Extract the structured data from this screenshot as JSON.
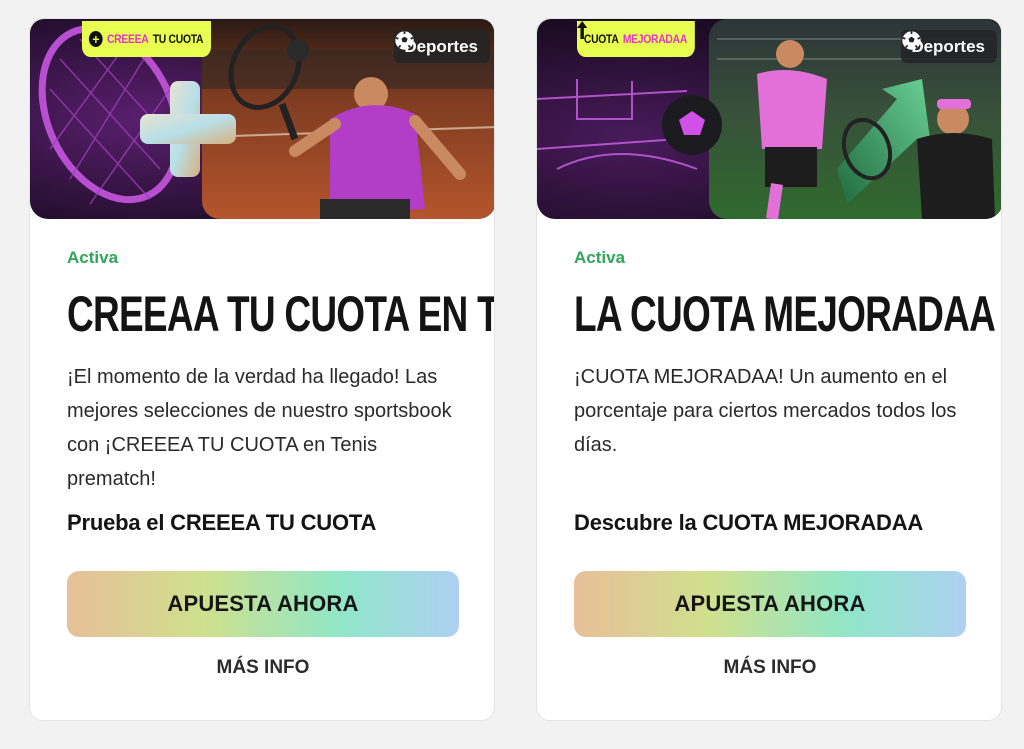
{
  "cards": [
    {
      "promo_tag": {
        "label_highlight": "CREEEA",
        "label_rest": "TU CUOTA",
        "icon": "plus-icon"
      },
      "sport_badge": {
        "label": "Deportes",
        "icon": "soccer-ball-icon"
      },
      "status": "Activa",
      "title": "CREEAA TU CUOTA EN TENIS",
      "description": "¡El momento de la verdad ha llegado! Las mejores selecciones de nuestro sportsbook con ¡CREEEA TU CUOTA en Tenis prematch!",
      "cta_text": "Prueba el CREEEA TU CUOTA",
      "button_label": "APUESTA AHORA",
      "more_info_label": "MÁS INFO"
    },
    {
      "promo_tag": {
        "label_rest": "CUOTA",
        "label_highlight": "MEJORADAA",
        "icon": "arrow-up-icon"
      },
      "sport_badge": {
        "label": "Deportes",
        "icon": "soccer-ball-icon"
      },
      "status": "Activa",
      "title": "LA CUOTA MEJORADAA",
      "description": "¡CUOTA MEJORADAA! Un aumento en el porcentaje para ciertos mercados todos los días.",
      "cta_text": "Descubre la CUOTA MEJORADAA",
      "button_label": "APUESTA AHORA",
      "more_info_label": "MÁS INFO"
    }
  ],
  "colors": {
    "status_green": "#2fa65a",
    "tag_yellow": "#e9ff4f",
    "tag_pink": "#e234c9",
    "button_gradient": [
      "#e7bf98",
      "#cfe08e",
      "#8fe6c8",
      "#aed0f2"
    ]
  }
}
